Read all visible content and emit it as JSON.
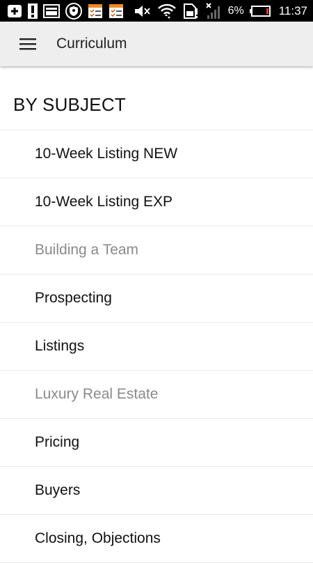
{
  "status_bar": {
    "battery_percent": "6%",
    "time": "11:37",
    "icons": [
      "add-icon",
      "alert-icon",
      "screen-icon",
      "shield-icon",
      "checklist-icon",
      "checklist-icon",
      "mute-icon",
      "wifi-icon",
      "sim-icon",
      "signal-icon",
      "battery-icon"
    ],
    "battery_color": "#e53935"
  },
  "app_bar": {
    "title": "Curriculum",
    "menu_icon": "menu-icon"
  },
  "section": {
    "header": "BY SUBJECT"
  },
  "items": [
    {
      "label": "10-Week Listing NEW",
      "enabled": true
    },
    {
      "label": "10-Week Listing EXP",
      "enabled": true
    },
    {
      "label": "Building a Team",
      "enabled": false
    },
    {
      "label": "Prospecting",
      "enabled": true
    },
    {
      "label": "Listings",
      "enabled": true
    },
    {
      "label": "Luxury Real Estate",
      "enabled": false
    },
    {
      "label": "Pricing",
      "enabled": true
    },
    {
      "label": "Buyers",
      "enabled": true
    },
    {
      "label": "Closing, Objections",
      "enabled": true
    }
  ],
  "colors": {
    "app_bar_bg": "#eeeeee",
    "text_primary": "#111111",
    "text_disabled": "#8a8a8a",
    "divider": "#e6e6e6"
  }
}
